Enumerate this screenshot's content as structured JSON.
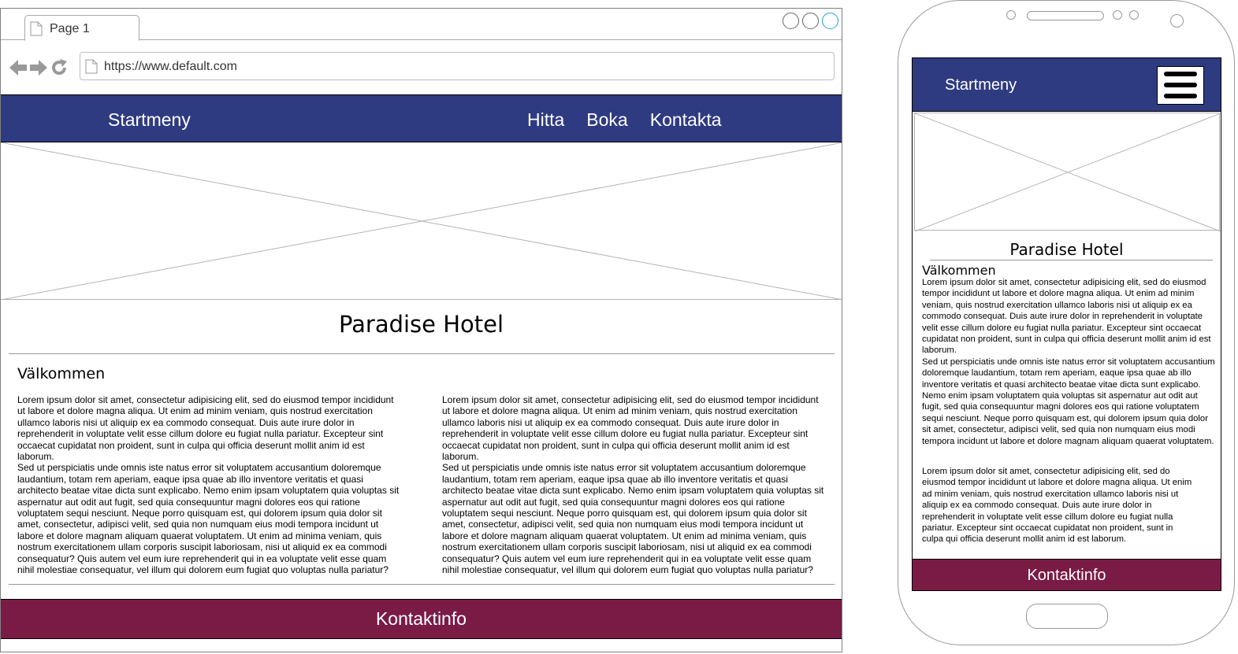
{
  "browser": {
    "tab_label": "Page 1",
    "url": "https://www.default.com"
  },
  "site": {
    "brand": "Startmeny",
    "nav_links": [
      "Hitta",
      "Boka",
      "Kontakta"
    ],
    "title": "Paradise Hotel",
    "welcome_heading": "Välkommen",
    "para1": "Lorem ipsum dolor sit amet, consectetur adipisicing elit, sed do eiusmod tempor incididunt ut labore et dolore magna aliqua. Ut enim ad minim veniam, quis nostrud exercitation ullamco laboris nisi ut aliquip ex ea commodo consequat. Duis aute irure dolor in reprehenderit in voluptate velit esse cillum dolore eu fugiat nulla pariatur. Excepteur sint occaecat cupidatat non proident, sunt in culpa qui officia deserunt mollit anim id est laborum.",
    "para2": "Sed ut perspiciatis unde omnis iste natus error sit voluptatem accusantium doloremque laudantium, totam rem aperiam, eaque ipsa quae ab illo inventore veritatis et quasi architecto beatae vitae dicta sunt explicabo. Nemo enim ipsam voluptatem quia voluptas sit aspernatur aut odit aut fugit, sed quia consequuntur magni dolores eos qui ratione voluptatem sequi nesciunt. Neque porro quisquam est, qui dolorem ipsum quia dolor sit amet, consectetur, adipisci velit, sed quia non numquam eius modi tempora incidunt ut labore et dolore magnam aliquam quaerat voluptatem. Ut enim ad minima veniam, quis nostrum exercitationem ullam corporis suscipit laboriosam, nisi ut aliquid ex ea commodi consequatur? Quis autem vel eum iure reprehenderit qui in ea voluptate velit esse quam nihil molestiae consequatur, vel illum qui dolorem eum fugiat quo voluptas nulla pariatur?",
    "mobile_para2": "Sed ut perspiciatis unde omnis iste natus error sit voluptatem accusantium doloremque laudantium, totam rem aperiam, eaque ipsa quae ab illo inventore veritatis et quasi architecto beatae vitae dicta sunt explicabo. Nemo enim ipsam voluptatem quia voluptas sit aspernatur aut odit aut fugit, sed quia consequuntur magni dolores eos qui ratione voluptatem sequi nesciunt. Neque porro quisquam est, qui dolorem ipsum quia dolor sit amet, consectetur, adipisci velit, sed quia non numquam eius modi tempora incidunt ut labore et dolore magnam aliquam quaerat voluptatem.",
    "footer": "Kontaktinfo"
  },
  "colors": {
    "nav_bg": "#2f3b80",
    "footer_bg": "#7a1b46"
  },
  "icons": [
    "page-icon",
    "back-arrow-icon",
    "forward-arrow-icon",
    "refresh-icon",
    "hamburger-menu-icon"
  ]
}
